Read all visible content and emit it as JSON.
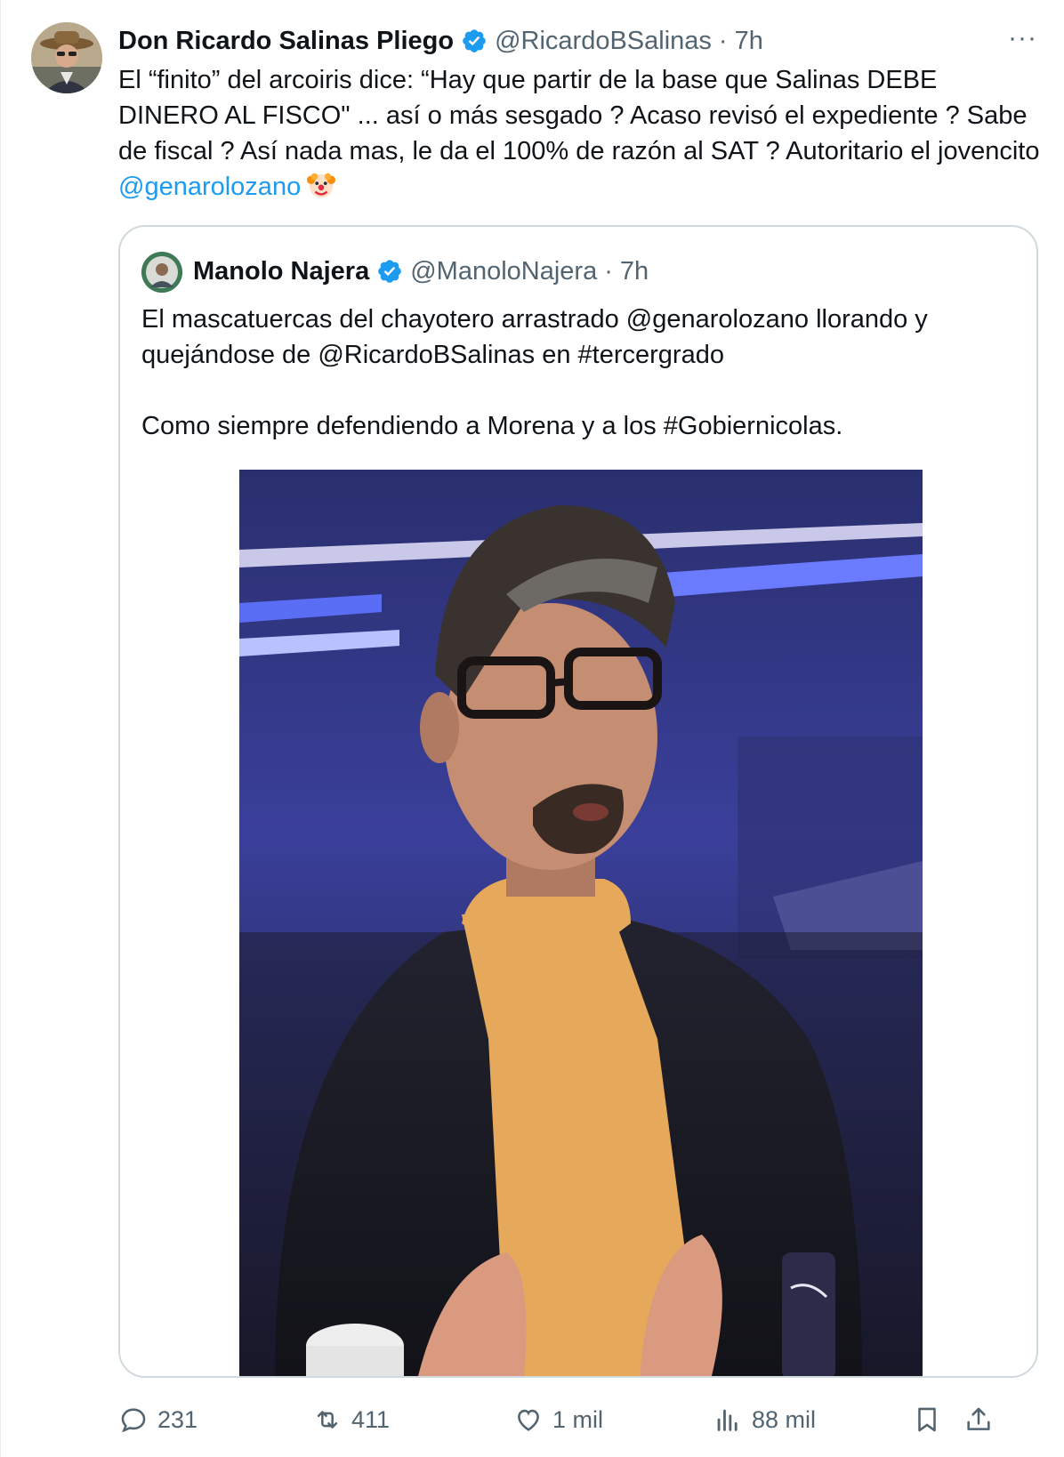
{
  "tweet": {
    "author": {
      "name": "Don Ricardo Salinas Pliego",
      "handle": "@RicardoBSalinas",
      "time": "7h",
      "separator": "·"
    },
    "text": {
      "part1": "El “finito” del arcoiris dice: “Hay que partir de la base que Salinas DEBE DINERO AL FISCO\" ... así o más sesgado ? Acaso revisó el expediente ? Sabe de fiscal ? Así nada mas, le da el 100% de razón al SAT ? Autoritario el jovencito ",
      "mention": "@genarolozano",
      "emoji_icon": "clown-face-icon"
    },
    "more_icon": "more-horizontal-icon",
    "more_label": "···"
  },
  "quote": {
    "author": {
      "name": "Manolo Najera",
      "handle": "@ManoloNajera",
      "time": "7h",
      "separator": "·"
    },
    "text": {
      "line1": "El mascatuercas del chayotero arrastrado @genarolozano llorando y quejándose de @RicardoBSalinas en #tercergrado",
      "line2": "Como siempre defendiendo a Morena y a los #Gobiernicolas."
    },
    "media_icon": "photo-man-glasses-tv-studio"
  },
  "actions": {
    "replies": "231",
    "reposts": "411",
    "likes": "1 mil",
    "views": "88 mil"
  },
  "colors": {
    "text": "#0f1419",
    "secondary": "#536471",
    "link": "#1d9bf0",
    "border": "#cfd9de",
    "verified": "#1d9bf0"
  }
}
